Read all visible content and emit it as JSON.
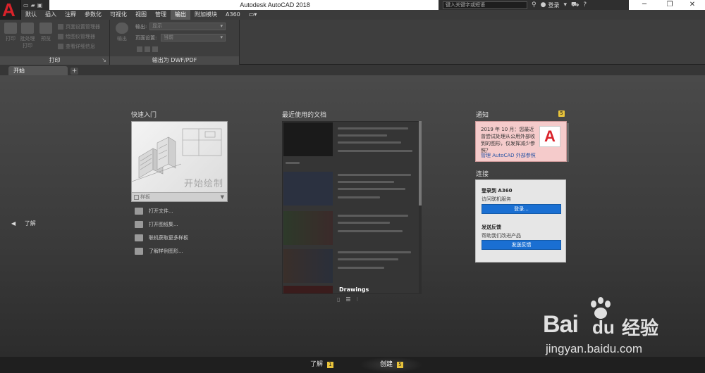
{
  "window": {
    "title": "Autodesk AutoCAD 2018",
    "search_placeholder": "键入关键字或短语",
    "login_label": "登录"
  },
  "menu_tabs": [
    "默认",
    "插入",
    "注释",
    "参数化",
    "可视化",
    "视图",
    "管理",
    "输出",
    "附加模块",
    "A360"
  ],
  "active_menu_tab": "输出",
  "ribbon": {
    "print_panel": {
      "title": "打印",
      "plot": "打印",
      "batch_plot": "批处理打印",
      "preview": "预览",
      "page_setup_manager": "页面设置管理器",
      "plotter_manager": "绘图仪管理器",
      "view_details": "查看详细信息"
    },
    "export_panel": {
      "title": "输出为 DWF/PDF",
      "export_label": "输出",
      "output_label": "输出:",
      "output_value": "显示",
      "page_setup_label": "页面设置:",
      "page_setup_value": "当前"
    }
  },
  "file_tabs": {
    "active": "开始",
    "add_symbol": "+"
  },
  "side": {
    "learn_label": "了解"
  },
  "quick_start": {
    "title": "快速入门",
    "start_drawing": "开始绘制",
    "template_label": "样板",
    "links": [
      "打开文件...",
      "打开图纸集...",
      "联机获取更多样板",
      "了解样例图形..."
    ]
  },
  "recent": {
    "title": "最近使用的文档",
    "last_item_label": "Drawings"
  },
  "notifications": {
    "title": "通知",
    "badge": "5",
    "message": "2019 年 10 月：您最近曾尝试处理从公用外部收到的图形，仅发挥减少参照？",
    "link": "管理 AutoCAD 外部参照"
  },
  "connect": {
    "title": "连接",
    "a360_heading": "登录到 A360",
    "a360_sub": "访问联机服务",
    "login_button": "登录...",
    "feedback_heading": "发送反馈",
    "feedback_sub": "帮助我们改进产品",
    "feedback_button": "发送反馈"
  },
  "bottom_tabs": [
    {
      "label": "了解",
      "badge": "1"
    },
    {
      "label": "创建",
      "badge": "5"
    }
  ],
  "watermark": {
    "brand": "Bai",
    "brand_suffix": "du",
    "brand_cn": "经验",
    "url": "jingyan.baidu.com"
  },
  "colors": {
    "accent_red": "#d9222a",
    "badge_yellow": "#e7c23b",
    "button_blue": "#1a6fd2",
    "notification_bg": "#f5cbcb"
  }
}
